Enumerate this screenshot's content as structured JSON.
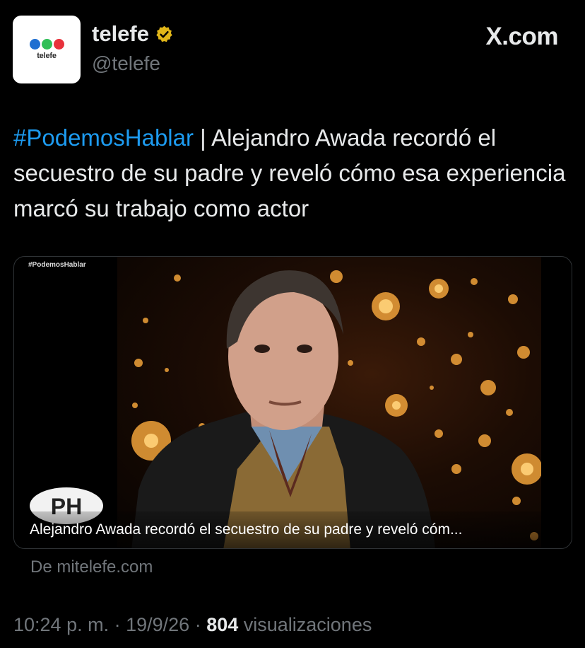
{
  "header": {
    "avatar_word": "telefe",
    "display_name": "telefe",
    "handle": "@telefe",
    "brand": "X.com",
    "logo_colors": [
      "#1f6fd1",
      "#2fbf57",
      "#e8323c"
    ]
  },
  "tweet": {
    "hashtag": "#PodemosHablar",
    "text": " | Alejandro Awada recordó el secuestro de su padre y reveló cómo esa experiencia marcó su trabajo como actor"
  },
  "card": {
    "overlay_tag": "#PodemosHablar",
    "badge_text": "PH",
    "caption": "Alejandro Awada recordó el secuestro de su padre y reveló cóm..."
  },
  "source": "De mitelefe.com",
  "meta": {
    "time": "10:24 p. m.",
    "sep1": " · ",
    "date": "19/9/26",
    "sep2": " · ",
    "views_count": "804",
    "views_label": " visualizaciones"
  },
  "colors": {
    "hashtag": "#1d9bf0",
    "verified": "#e2b719",
    "muted": "#71767b"
  }
}
